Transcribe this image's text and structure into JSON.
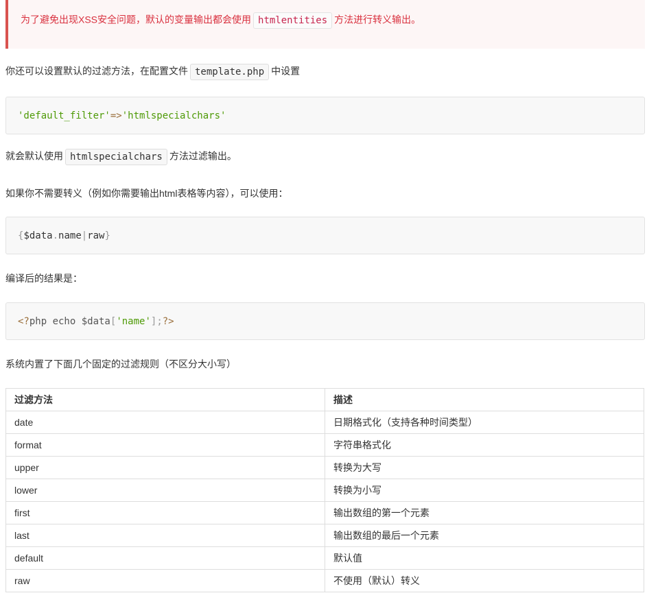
{
  "alert": {
    "before": "为了避免出现XSS安全问题，默认的变量输出都会使用",
    "code": "htmlentities",
    "after": "方法进行转义输出。"
  },
  "p1": {
    "before": "你还可以设置默认的过滤方法，在配置文件",
    "code": "template.php",
    "after": "中设置"
  },
  "code1": {
    "key": "'default_filter'",
    "arrow": "=>",
    "value": "'htmlspecialchars'"
  },
  "p2": {
    "before": "就会默认使用",
    "code": "htmlspecialchars",
    "after": "方法过滤输出。"
  },
  "p3": "如果你不需要转义（例如你需要输出html表格等内容），可以使用：",
  "code2": {
    "open": "{",
    "var": "$data",
    "dot": ".",
    "name": "name",
    "pipe": "|",
    "filter": "raw",
    "close": "}"
  },
  "p4": "编译后的结果是：",
  "code3": {
    "open": "<?",
    "body": "php echo $data",
    "lb": "[",
    "key": "'name'",
    "rb": "];",
    "close": "?>"
  },
  "p5": "系统内置了下面几个固定的过滤规则（不区分大小写）",
  "table": {
    "headers": [
      "过滤方法",
      "描述"
    ],
    "rows": [
      [
        "date",
        "日期格式化（支持各种时间类型）"
      ],
      [
        "format",
        "字符串格式化"
      ],
      [
        "upper",
        "转换为大写"
      ],
      [
        "lower",
        "转换为小写"
      ],
      [
        "first",
        "输出数组的第一个元素"
      ],
      [
        "last",
        "输出数组的最后一个元素"
      ],
      [
        "default",
        "默认值"
      ],
      [
        "raw",
        "不使用（默认）转义"
      ]
    ]
  }
}
